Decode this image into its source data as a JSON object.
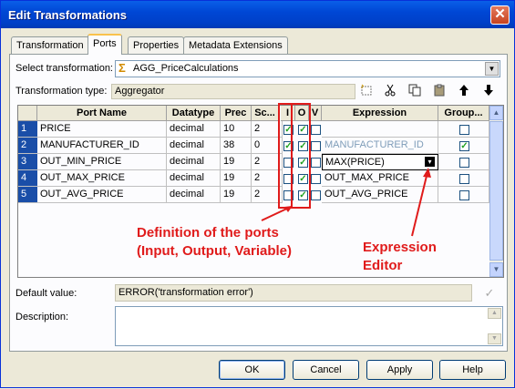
{
  "window": {
    "title": "Edit Transformations",
    "close_glyph": "✕"
  },
  "tabs": [
    {
      "label": "Transformation"
    },
    {
      "label": "Ports"
    },
    {
      "label": "Properties"
    },
    {
      "label": "Metadata Extensions"
    }
  ],
  "select_transformation": {
    "label": "Select transformation:",
    "value": "AGG_PriceCalculations",
    "icon": "sigma-aggregator-icon"
  },
  "transformation_type": {
    "label": "Transformation type:",
    "value": "Aggregator"
  },
  "toolbar_icons": [
    "new-port-icon",
    "cut-icon",
    "copy-icon",
    "paste-icon",
    "move-up-icon",
    "move-down-icon"
  ],
  "ports": {
    "columns": [
      "Port Name",
      "Datatype",
      "Prec",
      "Sc...",
      "I",
      "O",
      "V",
      "Expression",
      "Group..."
    ],
    "rows": [
      {
        "num": "1",
        "name": "PRICE",
        "datatype": "decimal",
        "prec": "10",
        "scale": "2",
        "I": true,
        "O": true,
        "V": false,
        "expression": "",
        "group_by": false
      },
      {
        "num": "2",
        "name": "MANUFACTURER_ID",
        "datatype": "decimal",
        "prec": "38",
        "scale": "0",
        "I": true,
        "O": true,
        "V": false,
        "expression": "MANUFACTURER_ID",
        "group_by": true
      },
      {
        "num": "3",
        "name": "OUT_MIN_PRICE",
        "datatype": "decimal",
        "prec": "19",
        "scale": "2",
        "I": false,
        "O": true,
        "V": false,
        "expression": "MAX(PRICE)",
        "group_by": false
      },
      {
        "num": "4",
        "name": "OUT_MAX_PRICE",
        "datatype": "decimal",
        "prec": "19",
        "scale": "2",
        "I": false,
        "O": true,
        "V": false,
        "expression": "OUT_MAX_PRICE",
        "group_by": false
      },
      {
        "num": "5",
        "name": "OUT_AVG_PRICE",
        "datatype": "decimal",
        "prec": "19",
        "scale": "2",
        "I": false,
        "O": true,
        "V": false,
        "expression": "OUT_AVG_PRICE",
        "group_by": false
      }
    ]
  },
  "annotations": {
    "ports_line1": "Definition of the ports",
    "ports_line2": "(Input, Output, Variable)",
    "expr_line1": "Expression",
    "expr_line2": "Editor",
    "color": "#e01b1b"
  },
  "default_value": {
    "label": "Default value:",
    "value": "ERROR('transformation error')"
  },
  "description": {
    "label": "Description:",
    "value": ""
  },
  "buttons": {
    "ok": "OK",
    "cancel": "Cancel",
    "apply": "Apply",
    "help": "Help"
  },
  "colors": {
    "titlebar": "#0047d5",
    "row_header": "#1a4ea8",
    "check": "#21a121"
  }
}
